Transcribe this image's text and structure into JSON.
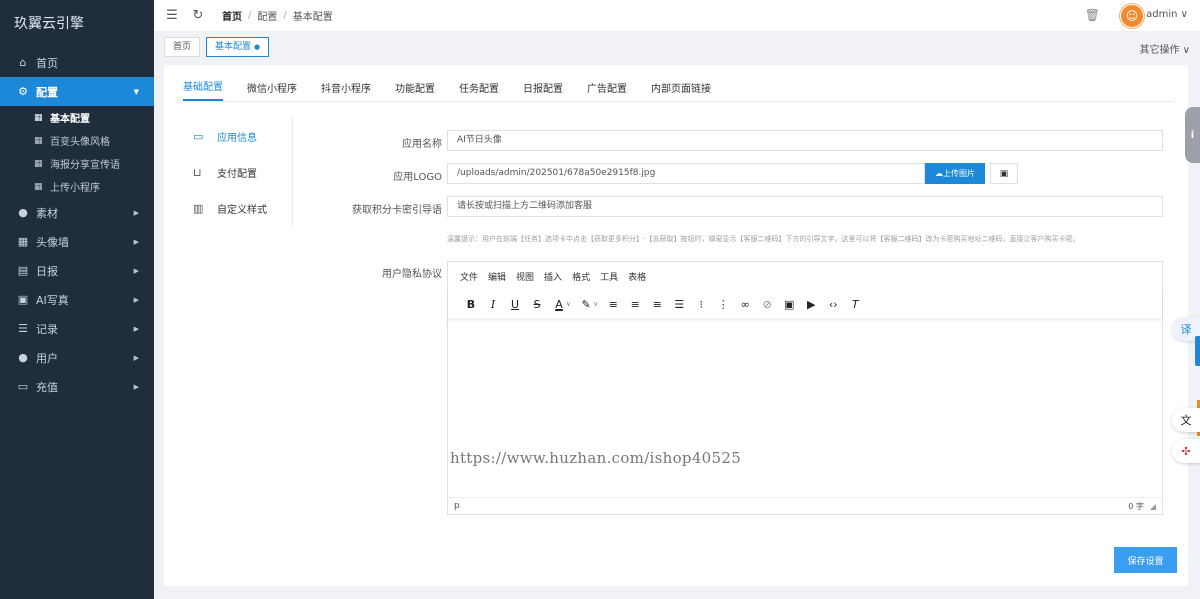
{
  "brand": "玖翼云引擎",
  "sidebar": {
    "items": [
      {
        "label": "首页",
        "icon": "home-icon",
        "glyph": "⌂"
      },
      {
        "label": "配置",
        "icon": "settings-icon",
        "glyph": "⚙"
      },
      {
        "label": "素材",
        "icon": "location-icon",
        "glyph": "●"
      },
      {
        "label": "头像墙",
        "icon": "grid-icon",
        "glyph": "▦"
      },
      {
        "label": "日报",
        "icon": "calendar-icon",
        "glyph": "▤"
      },
      {
        "label": "AI写真",
        "icon": "image-icon",
        "glyph": "▣"
      },
      {
        "label": "记录",
        "icon": "sliders-icon",
        "glyph": "☰"
      },
      {
        "label": "用户",
        "icon": "user-icon",
        "glyph": "●"
      },
      {
        "label": "充值",
        "icon": "card-icon",
        "glyph": "▭"
      }
    ],
    "sub_items": [
      "基本配置",
      "百变头像风格",
      "海报分享宣传语",
      "上传小程序"
    ]
  },
  "topbar": {
    "breadcrumb": [
      "首页",
      "配置",
      "基本配置"
    ],
    "user": "admin"
  },
  "page_tabs": {
    "home": "首页",
    "current": "基本配置",
    "other_ops": "其它操作"
  },
  "content_tabs": [
    "基础配置",
    "微信小程序",
    "抖音小程序",
    "功能配置",
    "任务配置",
    "日报配置",
    "广告配置",
    "内部页面链接"
  ],
  "vnav": [
    "应用信息",
    "支付配置",
    "自定义样式"
  ],
  "form": {
    "app_name_label": "应用名称",
    "app_name_value": "AI节日头像",
    "logo_label": "应用LOGO",
    "logo_value": "/uploads/admin/202501/678a50e2915f8.jpg",
    "upload_label": "上传图片",
    "guide_label": "获取积分卡密引导语",
    "guide_value": "请长按或扫描上方二维码添加客服",
    "tip": "温馨提示：用户在前端【任务】选项卡中点击【获取更多积分】-【去获取】按钮时，弹窗显示【客服二维码】下方的引导文字，这里可以将【客服二维码】改为卡密购买地址二维码，直接让客户购买卡密。",
    "privacy_label": "用户隐私协议"
  },
  "editor": {
    "menu": [
      "文件",
      "编辑",
      "视图",
      "插入",
      "格式",
      "工具",
      "表格"
    ],
    "status_path": "p",
    "word_count": "0 字"
  },
  "watermark": "https://www.huzhan.com/ishop40525",
  "save_label": "保存设置",
  "floating": {
    "translate": "译"
  },
  "colors": {
    "accent": "#1e88d8",
    "sidebar_bg": "#1f2d3d"
  }
}
